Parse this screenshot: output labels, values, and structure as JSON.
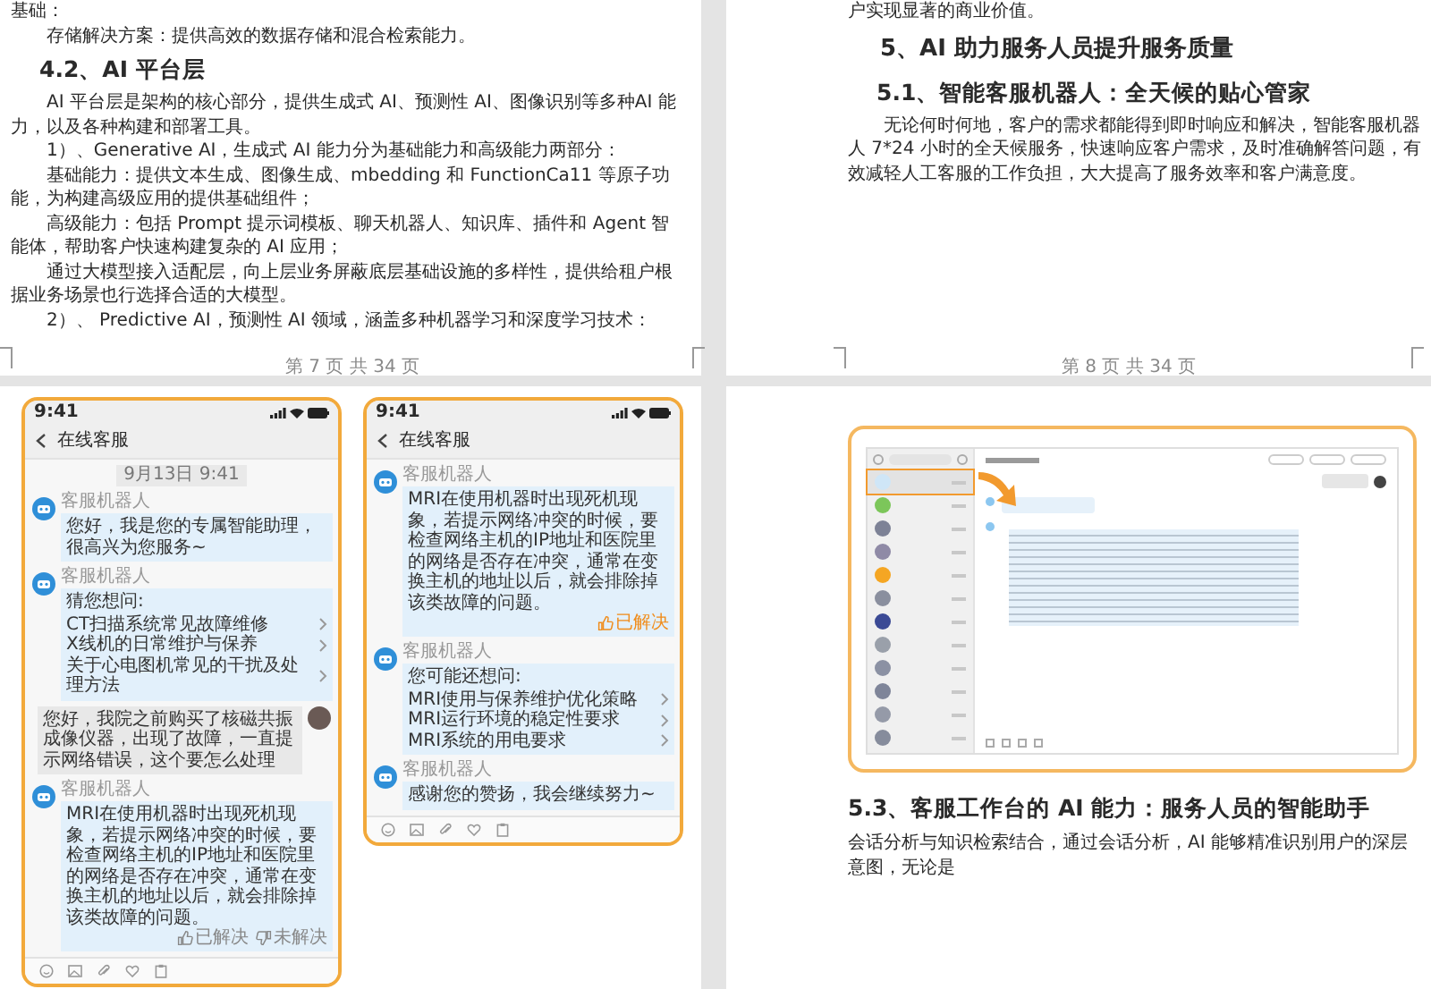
{
  "top_left_page": {
    "blocks": [
      {
        "kind": "cont",
        "text": "基础："
      },
      {
        "kind": "para",
        "text": "存储解决方案：提供高效的数据存储和混合检索能力。"
      },
      {
        "kind": "h3",
        "text": "4.2、AI 平台层"
      },
      {
        "kind": "para",
        "text": "AI 平台层是架构的核心部分，提供生成式 AI、预测性 AI、图像识别等多种AI 能力，以及各种构建和部署工具。"
      },
      {
        "kind": "para",
        "text": "1）、Generative AI，生成式 AI 能力分为基础能力和高级能力两部分："
      },
      {
        "kind": "para",
        "text": "基础能力：提供文本生成、图像生成、mbedding 和 FunctionCa11 等原子功能，为构建高级应用的提供基础组件；"
      },
      {
        "kind": "para",
        "text": "高级能力：包括 Prompt 提示词模板、聊天机器人、知识库、插件和 Agent 智能体，帮助客户快速构建复杂的 AI 应用；"
      },
      {
        "kind": "para",
        "text": "通过大模型接入适配层，向上层业务屏蔽底层基础设施的多样性，提供给租户根据业务场景也行选择合适的大模型。"
      },
      {
        "kind": "para",
        "text": "2）、 Predictive AI，预测性 AI 领域，涵盖多种机器学习和深度学习技术："
      }
    ],
    "footer": "第 7 页 共 34 页"
  },
  "top_right_page": {
    "blocks": [
      {
        "kind": "cont",
        "text": "户实现显著的商业价值。"
      },
      {
        "kind": "h2",
        "text": "5、AI 助力服务人员提升服务质量"
      },
      {
        "kind": "h3",
        "text": "5.1、智能客服机器人：全天候的贴心管家"
      },
      {
        "kind": "para",
        "text": "无论何时何地，客户的需求都能得到即时响应和解决，智能客服机器人 7*24 小时的全天候服务，快速响应客户需求，及时准确解答问题，有效减轻人工客服的工作负担，大大提高了服务效率和客户满意度。"
      }
    ],
    "footer": "第 8 页 共 34 页"
  },
  "bottom_left_page": {
    "phones": [
      {
        "time": "9:41",
        "title": "在线客服",
        "messages": [
          {
            "kind": "timestamp",
            "text": "9月13日 9:41"
          },
          {
            "kind": "bot",
            "sender": "客服机器人",
            "text": "您好，我是您的专属智能助理，很高兴为您服务~"
          },
          {
            "kind": "suggestions",
            "sender": "客服机器人",
            "intro": "猜您想问:",
            "items": [
              "CT扫描系统常见故障维修",
              "X线机的日常维护与保养",
              "关于心电图机常见的干扰及处理方法"
            ]
          },
          {
            "kind": "user",
            "text": "您好，我院之前购买了核磁共振成像仪器，出现了故障，一直提示网络错误，这个要怎么处理"
          },
          {
            "kind": "bot",
            "sender": "客服机器人",
            "text": "MRI在使用机器时出现死机现象，若提示网络冲突的时候，要检查网络主机的IP地址和医院里的网络是否存在冲突，通常在变换主机的地址以后，就会排除掉该类故障的问题。",
            "feedback": [
              {
                "kind": "up",
                "label": "已解决",
                "selected": false
              },
              {
                "kind": "down",
                "label": "未解决",
                "selected": false
              }
            ]
          }
        ]
      },
      {
        "time": "9:41",
        "title": "在线客服",
        "messages": [
          {
            "kind": "bot",
            "sender": "客服机器人",
            "text": "MRI在使用机器时出现死机现象，若提示网络冲突的时候，要检查网络主机的IP地址和医院里的网络是否存在冲突，通常在变换主机的地址以后，就会排除掉该类故障的问题。",
            "feedback": [
              {
                "kind": "up",
                "label": "已解决",
                "selected": true
              }
            ]
          },
          {
            "kind": "suggestions",
            "sender": "客服机器人",
            "intro": "您可能还想问:",
            "items": [
              "MRI使用与保养维护优化策略",
              "MRI运行环境的稳定性要求",
              "MRI系统的用电要求"
            ]
          },
          {
            "kind": "bot",
            "sender": "客服机器人",
            "text": "感谢您的赞扬，我会继续努力~"
          }
        ]
      }
    ]
  },
  "bottom_right_page": {
    "sidebar_items": [
      {
        "selected": true,
        "color": "#cfe6f7"
      },
      {
        "selected": false,
        "color": "#7cc65a"
      },
      {
        "selected": false,
        "color": "#7d8296"
      },
      {
        "selected": false,
        "color": "#8f8aa6"
      },
      {
        "selected": false,
        "color": "#f5a623"
      },
      {
        "selected": false,
        "color": "#8a8f9e"
      },
      {
        "selected": false,
        "color": "#3b4a95"
      },
      {
        "selected": false,
        "color": "#9aa0aa"
      },
      {
        "selected": false,
        "color": "#8b91a3"
      },
      {
        "selected": false,
        "color": "#7f8599"
      },
      {
        "selected": false,
        "color": "#959aa8"
      },
      {
        "selected": false,
        "color": "#868c9c"
      }
    ],
    "blocks": [
      {
        "kind": "h3",
        "text": "5.3、客服工作台的 AI 能力：服务人员的智能助手"
      },
      {
        "kind": "cont",
        "text": "会话分析与知识检索结合，通过会话分析，AI 能够精准识别用户的深层意图，无论是"
      }
    ]
  }
}
